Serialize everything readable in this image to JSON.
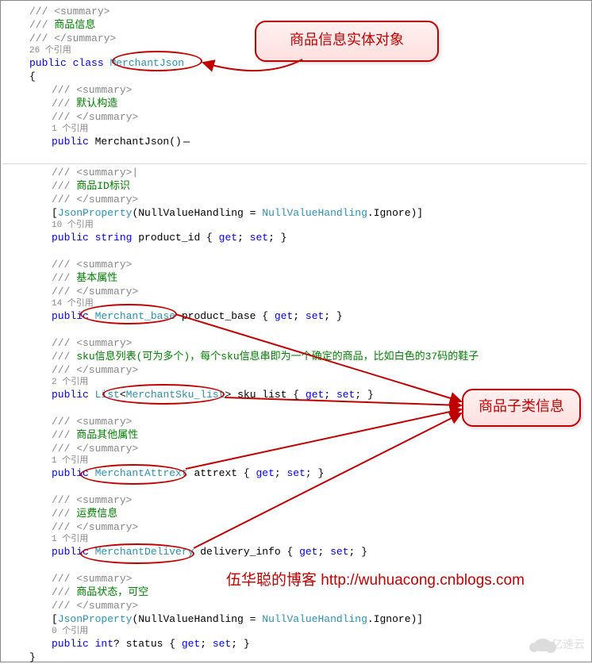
{
  "callouts": {
    "entity": "商品信息实体对象",
    "subclass": "商品子类信息"
  },
  "watermark_text": "伍华聪的博客 http://wuhuacong.cnblogs.com",
  "brand": "亿速云",
  "fold": "...",
  "code": {
    "summary_open": "/// <summary>",
    "summary_open_caret": "/// <summary>|",
    "summary_close": "/// </summary>",
    "slashes": "/// ",
    "comment1": "商品信息",
    "ref26": "26 个引用",
    "public": "public",
    "class_kw": "class",
    "cls_name": "MerchantJson",
    "brace_open": "{",
    "brace_close": "}",
    "comment_default_ctor": "默认构造",
    "ref1": "1 个引用",
    "ctor_sig": " MerchantJson()",
    "comment_product_id": "商品ID标识",
    "jsonprop_open": "[",
    "jsonprop_attr": "JsonProperty",
    "jsonprop_args_a": "(NullValueHandling = ",
    "jsonprop_enum": "NullValueHandling",
    "jsonprop_args_b": ".Ignore)]",
    "ref10": "10 个引用",
    "string_kw": "string",
    "product_id_line": " product_id { ",
    "get": "get",
    "set": "set",
    "semi": "; ",
    "semi_close": "; }",
    "comment_base": "基本属性",
    "ref14": "14 个引用",
    "type_merchant_base": "Merchant_base",
    "base_tail": " product_base { ",
    "comment_sku": "sku信息列表(可为多个)，每个sku信息串即为一个确定的商品，比如白色的37码的鞋子",
    "ref2": "2 个引用",
    "list_kw": "List",
    "lt": "<",
    "gt": ">",
    "type_sku": "MerchantSku_list",
    "sku_tail": " sku_list { ",
    "comment_other": "商品其他属性",
    "type_attrext": "MerchantAttrext",
    "attrext_tail": " attrext { ",
    "comment_delivery": "运费信息",
    "type_delivery": "MerchantDelivery",
    "delivery_tail": " delivery_info { ",
    "comment_status": "商品状态，可空",
    "ref0": "0 个引用",
    "int_kw": "int",
    "status_line": "? status { "
  }
}
